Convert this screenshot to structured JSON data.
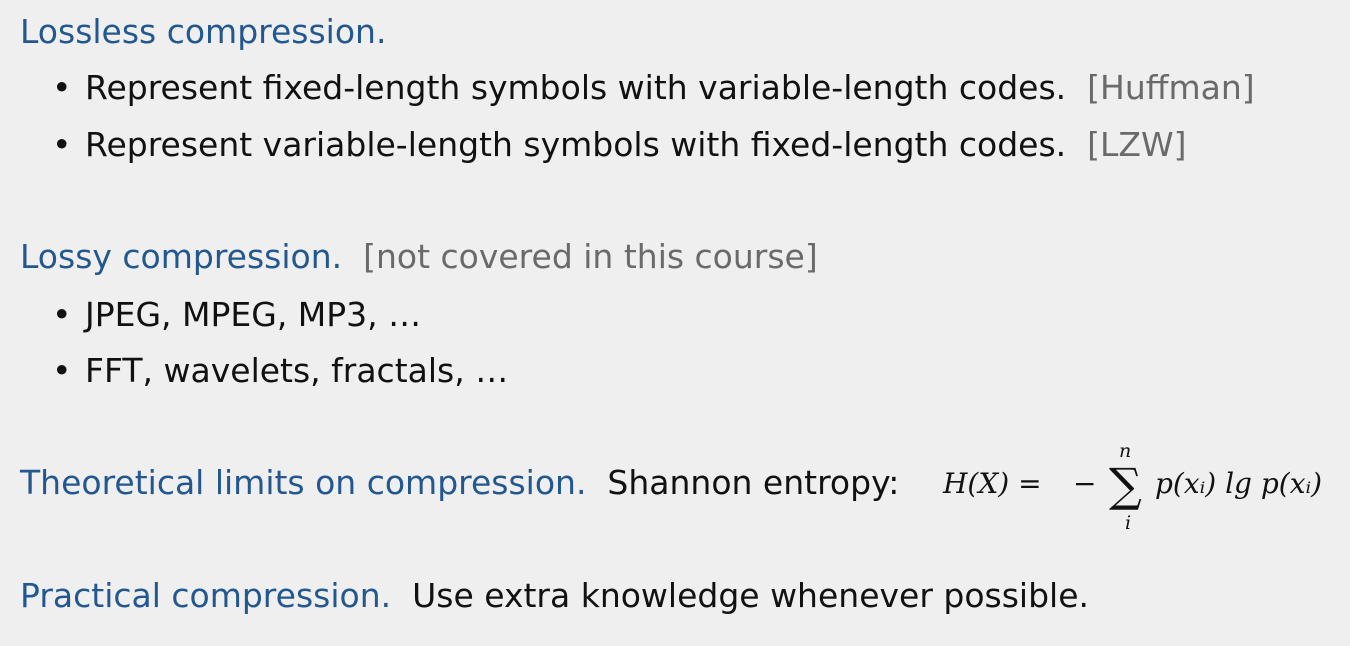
{
  "lossless": {
    "title": "Lossless compression.",
    "bullets": [
      {
        "text": "Represent fixed-length symbols with variable-length codes.",
        "note": "[Huffman]"
      },
      {
        "text": "Represent variable-length symbols with fixed-length codes.",
        "note": "[LZW]"
      }
    ]
  },
  "lossy": {
    "title": "Lossy compression.",
    "note": "[not covered in this course]",
    "bullets": [
      {
        "text": "JPEG, MPEG, MP3, …"
      },
      {
        "text": "FFT, wavelets, fractals, …"
      }
    ]
  },
  "theoretical": {
    "title": "Theoretical limits on compression.",
    "text": "Shannon entropy:",
    "formula": {
      "lhs": "H(X) =",
      "minus": "−",
      "sum_symbol": "∑",
      "upper": "n",
      "lower": "i",
      "term": "p(xᵢ) lg p(xᵢ)"
    }
  },
  "practical": {
    "title": "Practical compression.",
    "text": "Use extra knowledge whenever possible."
  },
  "bullet_symbol": "•"
}
